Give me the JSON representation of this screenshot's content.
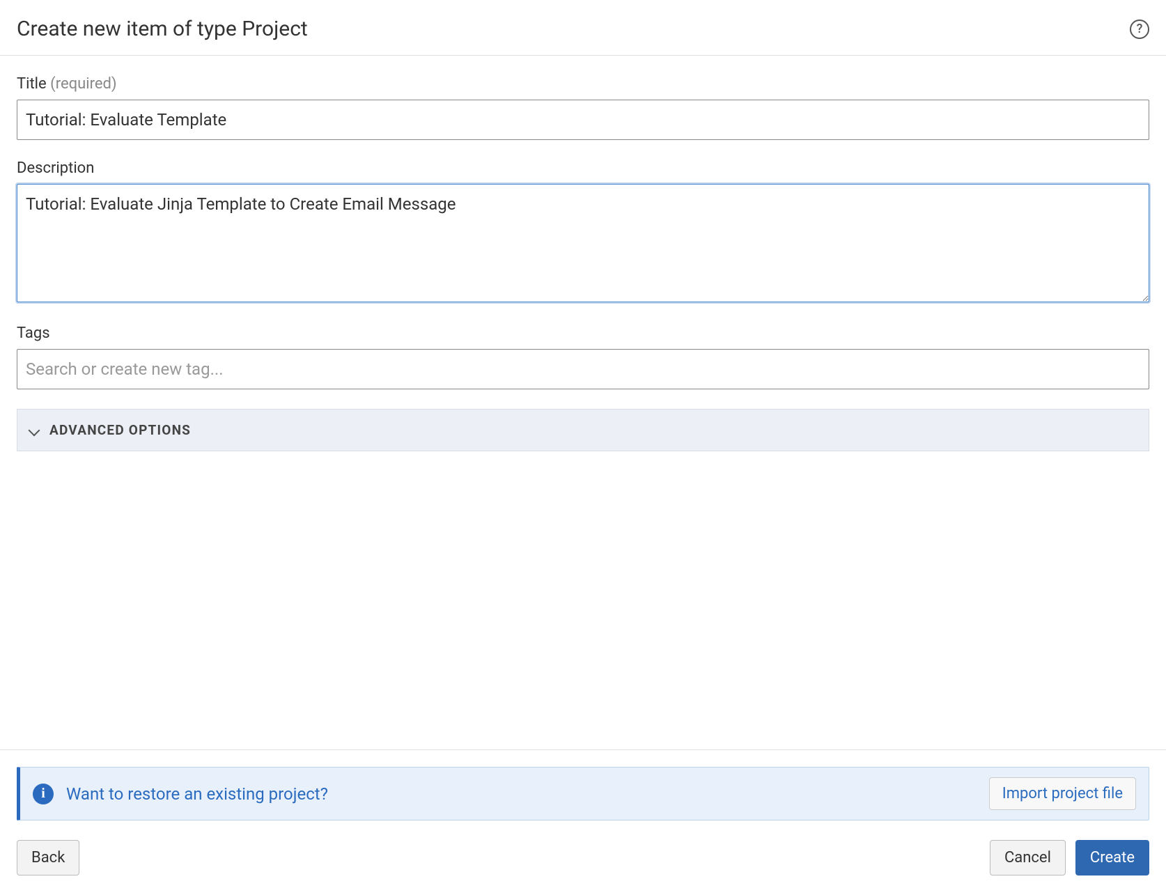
{
  "header": {
    "title": "Create new item of type Project"
  },
  "fields": {
    "title": {
      "label": "Title",
      "required_text": "(required)",
      "value": "Tutorial: Evaluate Template"
    },
    "description": {
      "label": "Description",
      "value": "Tutorial: Evaluate Jinja Template to Create Email Message"
    },
    "tags": {
      "label": "Tags",
      "placeholder": "Search or create new tag..."
    }
  },
  "advanced": {
    "label": "ADVANCED OPTIONS"
  },
  "footer": {
    "info_text": "Want to restore an existing project?",
    "import_button": "Import project file",
    "back_button": "Back",
    "cancel_button": "Cancel",
    "create_button": "Create"
  }
}
